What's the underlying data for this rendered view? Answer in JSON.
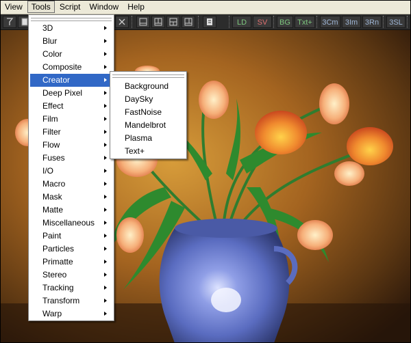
{
  "menubar": {
    "items": [
      {
        "label": "View"
      },
      {
        "label": "Tools"
      },
      {
        "label": "Script"
      },
      {
        "label": "Window"
      },
      {
        "label": "Help"
      }
    ]
  },
  "toolbar": {
    "buttons": [
      {
        "label": "LD",
        "color": "#7fc97f"
      },
      {
        "label": "SV",
        "color": "#e07070"
      },
      {
        "label": "BG",
        "color": "#7fc97f"
      },
      {
        "label": "Txt+",
        "color": "#7fc97f"
      },
      {
        "label": "3Cm",
        "color": "#9fb6d6"
      },
      {
        "label": "3Im",
        "color": "#9fb6d6"
      },
      {
        "label": "3Rn",
        "color": "#9fb6d6"
      },
      {
        "label": "3SL",
        "color": "#9fb6d6"
      }
    ]
  },
  "tools_menu": {
    "items": [
      {
        "label": "3D"
      },
      {
        "label": "Blur"
      },
      {
        "label": "Color"
      },
      {
        "label": "Composite"
      },
      {
        "label": "Creator"
      },
      {
        "label": "Deep Pixel"
      },
      {
        "label": "Effect"
      },
      {
        "label": "Film"
      },
      {
        "label": "Filter"
      },
      {
        "label": "Flow"
      },
      {
        "label": "Fuses"
      },
      {
        "label": "I/O"
      },
      {
        "label": "Macro"
      },
      {
        "label": "Mask"
      },
      {
        "label": "Matte"
      },
      {
        "label": "Miscellaneous"
      },
      {
        "label": "Paint"
      },
      {
        "label": "Particles"
      },
      {
        "label": "Primatte"
      },
      {
        "label": "Stereo"
      },
      {
        "label": "Tracking"
      },
      {
        "label": "Transform"
      },
      {
        "label": "Warp"
      }
    ],
    "selected": "Creator"
  },
  "creator_submenu": {
    "items": [
      {
        "label": "Background"
      },
      {
        "label": "DaySky"
      },
      {
        "label": "FastNoise"
      },
      {
        "label": "Mandelbrot"
      },
      {
        "label": "Plasma"
      },
      {
        "label": "Text+"
      }
    ]
  },
  "colors": {
    "highlight": "#3168c6"
  }
}
